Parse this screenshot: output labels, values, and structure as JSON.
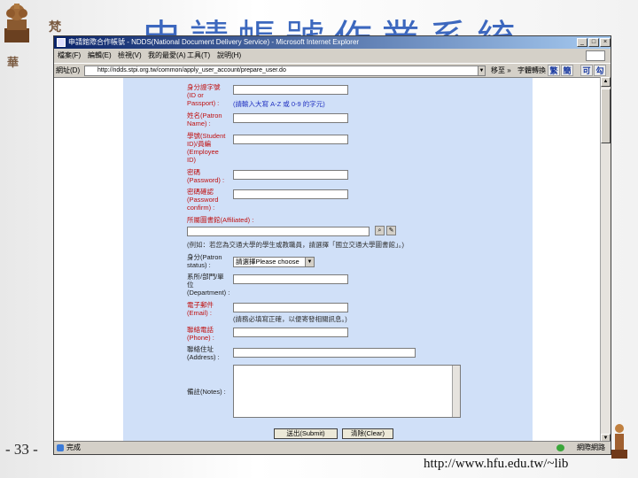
{
  "slide": {
    "bg_title": "申請帳號作業系統",
    "calli_left": "華",
    "calli_top": "梵",
    "number": "- 33 -",
    "url": "http://www.hfu.edu.tw/~lib"
  },
  "browser": {
    "title": "申請館際合作帳號 - NDDS(National Document Delivery Service) - Microsoft Internet Explorer",
    "menu": [
      "檔案(F)",
      "編輯(E)",
      "檢視(V)",
      "我的最愛(A)",
      "工具(T)",
      "說明(H)"
    ],
    "address_label": "網址(D)",
    "address": "http://ndds.stpi.org.tw/common/apply_user_account/prepare_user.do",
    "go": "移至",
    "conv": "字體轉換",
    "zh_buttons": [
      "繁",
      "簡",
      "可",
      "勾"
    ],
    "status_text": "完成",
    "status_zone": "網際網路"
  },
  "form": {
    "id_label": "身分證字號\n(ID or\nPassport) :",
    "id_hint": "(請輸入大寫 A-Z 或 0-9 的字元)",
    "name_label": "姓名(Patron\nName) :",
    "student_label": "學號(Student\nID)/員編\n(Employee\nID)",
    "password_label": "密碼\n(Password) :",
    "confirm_label": "密碼確認\n(Password\nconfirm) :",
    "affiliated_label": "所屬圖書館(Affiliated) :",
    "affiliated_hint": "(例如：若您為交通大學的學生或教職員，請選擇「國立交通大學圖書館」。)",
    "status_label": "身分(Patron\nstatus) :",
    "status_select": "請選擇Please choose",
    "dept_label": "系所/部門/單\n位\n(Department) :",
    "email_label": "電子郵件\n(Email) :",
    "email_hint": "(請務必填寫正確，以便寄發相關訊息。)",
    "phone_label": "聯絡電話\n(Phone) :",
    "address_label": "聯絡住址\n(Address) :",
    "notes_label": "備註(Notes) :",
    "submit": "送出(Submit)",
    "clear": "清除(Clear)"
  }
}
